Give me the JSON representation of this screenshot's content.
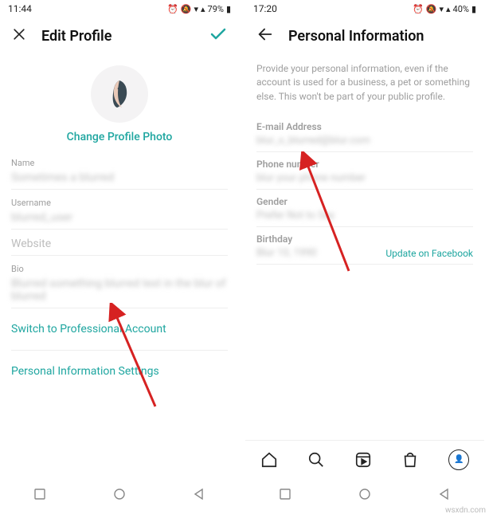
{
  "left": {
    "status": {
      "time": "11:44",
      "battery": "79%"
    },
    "title": "Edit Profile",
    "change_photo": "Change Profile Photo",
    "fields": {
      "name_label": "Name",
      "name_value": "Sometimes a blurred",
      "username_label": "Username",
      "username_value": "blurred_user",
      "website_label": "Website",
      "website_value": "",
      "bio_label": "Bio",
      "bio_value": "Blurred something blurred text in the blur of blurred"
    },
    "switch_pro": "Switch to Professional Account",
    "personal_info": "Personal Information Settings"
  },
  "right": {
    "status": {
      "time": "17:20",
      "battery": "40%"
    },
    "title": "Personal Information",
    "desc": "Provide your personal information, even if the account is used for a business, a pet or something else. This won't be part of your public profile.",
    "email_label": "E-mail Address",
    "email_value": "blur_x_blurred@blur.com",
    "phone_label": "Phone number",
    "phone_value": "blur your phone number",
    "gender_label": "Gender",
    "gender_value": "Prefer Not to Say",
    "birthday_label": "Birthday",
    "birthday_value": "Blur 10, 1990",
    "update_fb": "Update on Facebook"
  },
  "watermark": "wsxdn.com"
}
